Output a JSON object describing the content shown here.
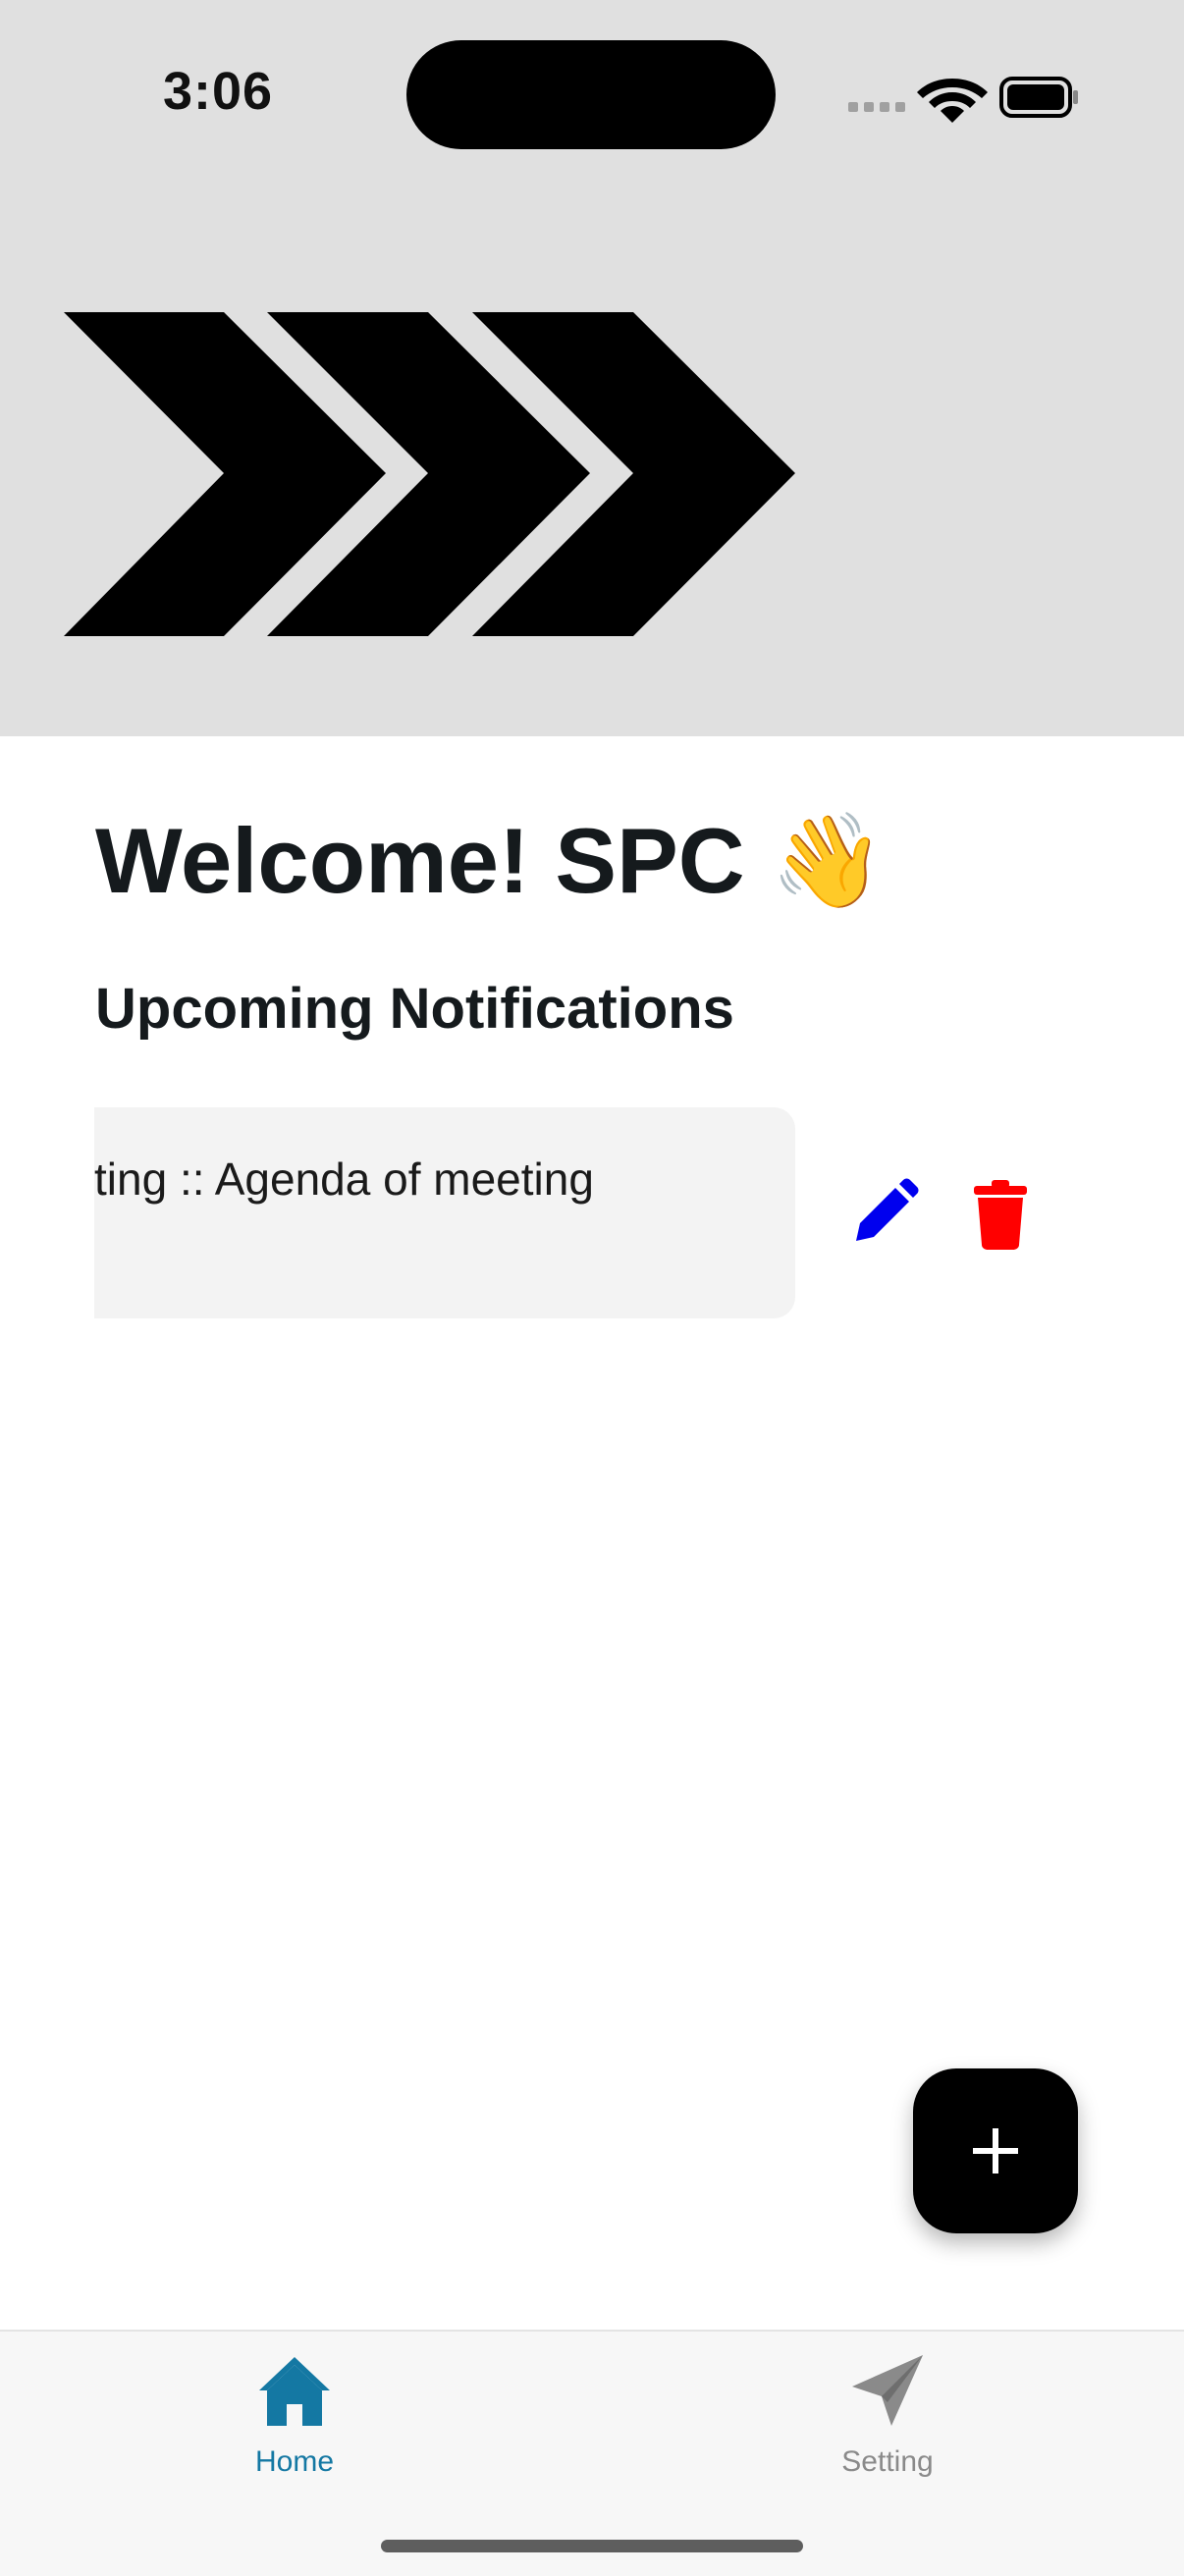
{
  "status_bar": {
    "time": "3:06"
  },
  "main": {
    "welcome_title": "Welcome! SPC 👋",
    "section_title": "Upcoming Notifications",
    "notifications": [
      {
        "text": "ting :: Agenda of meeting"
      }
    ]
  },
  "colors": {
    "edit_icon": "#0000ee",
    "delete_icon": "#ff0000",
    "tab_active": "#1478a3",
    "tab_inactive": "#8a8a8a",
    "header_bg": "#e0e0e0"
  },
  "fab": {
    "label": "+"
  },
  "tabbar": {
    "tabs": [
      {
        "label": "Home",
        "icon": "house-icon",
        "active": true
      },
      {
        "label": "Setting",
        "icon": "paper-plane-icon",
        "active": false
      }
    ]
  }
}
